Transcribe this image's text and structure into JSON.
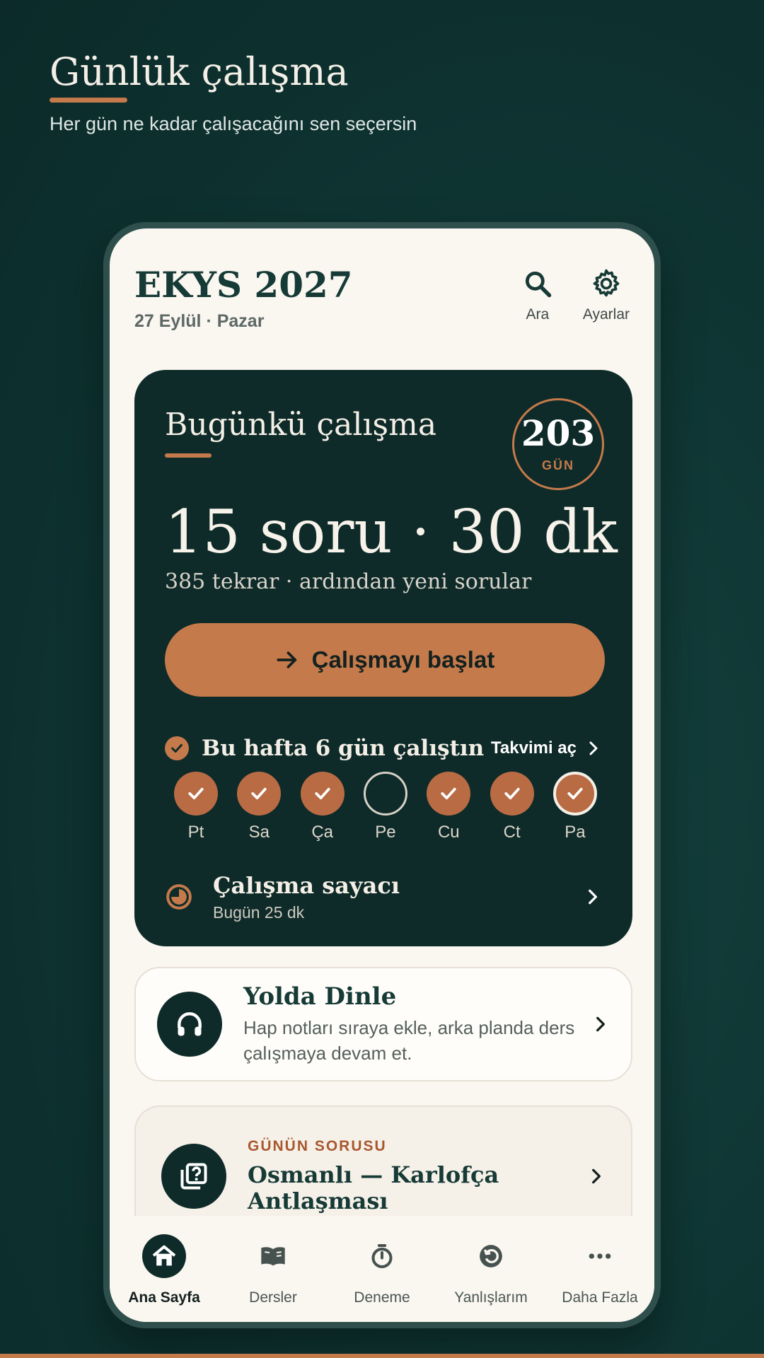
{
  "hero": {
    "title": "Günlük çalışma",
    "subtitle": "Her gün ne kadar çalışacağını sen seçersin"
  },
  "header": {
    "title": "EKYS 2027",
    "date": "27 Eylül · Pazar",
    "search_label": "Ara",
    "settings_label": "Ayarlar"
  },
  "study": {
    "title": "Bugünkü çalışma",
    "streak_count": "203",
    "streak_unit": "GÜN",
    "main": "15 soru · 30 dk",
    "detail": "385 tekrar · ardından yeni sorular",
    "start_label": "Çalışmayı başlat",
    "week_text": "Bu hafta 6 gün çalıştın",
    "calendar_link": "Takvimi aç",
    "days": [
      {
        "label": "Pt",
        "done": true
      },
      {
        "label": "Sa",
        "done": true
      },
      {
        "label": "Ça",
        "done": true
      },
      {
        "label": "Pe",
        "done": false
      },
      {
        "label": "Cu",
        "done": true
      },
      {
        "label": "Ct",
        "done": true
      },
      {
        "label": "Pa",
        "done": true,
        "today": true
      }
    ],
    "timer_title": "Çalışma sayacı",
    "timer_sub": "Bugün 25 dk"
  },
  "listen": {
    "title": "Yolda Dinle",
    "desc": "Hap notları sıraya ekle, arka planda ders çalışmaya devam et."
  },
  "qod": {
    "label": "GÜNÜN SORUSU",
    "title": "Osmanlı — Karlofça Antlaşması"
  },
  "nav": [
    {
      "label": "Ana Sayfa",
      "icon": "home-icon",
      "active": true
    },
    {
      "label": "Dersler",
      "icon": "book-icon"
    },
    {
      "label": "Deneme",
      "icon": "stopwatch-icon"
    },
    {
      "label": "Yanlışlarım",
      "icon": "retry-icon"
    },
    {
      "label": "Daha Fazla",
      "icon": "more-icon"
    }
  ],
  "colors": {
    "background": "#0f3634",
    "accent": "#c57a4b",
    "card_dark": "#0e2b29",
    "screen": "#faf6f0"
  }
}
